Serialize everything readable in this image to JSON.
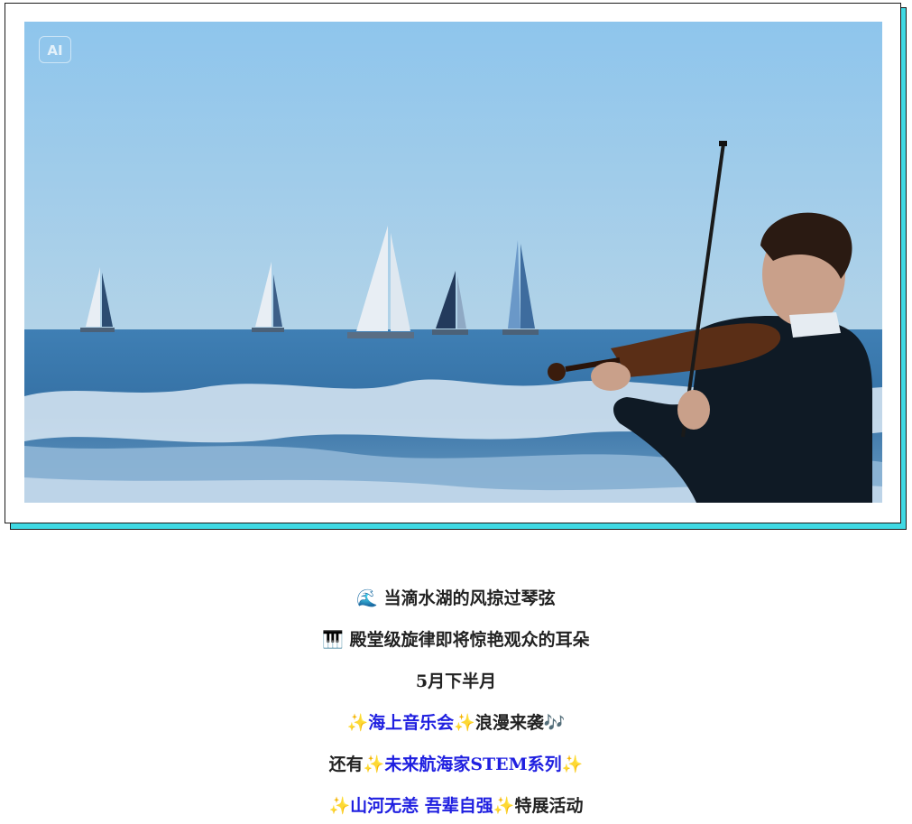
{
  "image": {
    "ai_badge": "AI",
    "description_icon": "sea-concert-photo"
  },
  "text_lines": {
    "line1": {
      "icon": "🌊",
      "text": "当滴水湖的风掠过琴弦"
    },
    "line2": {
      "icon": "🎹",
      "text": "殿堂级旋律即将惊艳观众的耳朵"
    },
    "line3": {
      "text": "5月下半月"
    },
    "line4": {
      "spark": "✨",
      "highlight": "海上音乐会",
      "rest": "浪漫来袭",
      "end_icon": "🎶"
    },
    "line5": {
      "prefix": "还有",
      "spark": "✨",
      "highlight": "未来航海家STEM系列"
    },
    "line6": {
      "spark": "✨",
      "highlight": "山河无恙 吾辈自强",
      "rest": "特展活动"
    }
  },
  "colors": {
    "accent_shadow": "#3fd9e3",
    "highlight_text": "#1f1fe0",
    "body_text": "#222222"
  }
}
